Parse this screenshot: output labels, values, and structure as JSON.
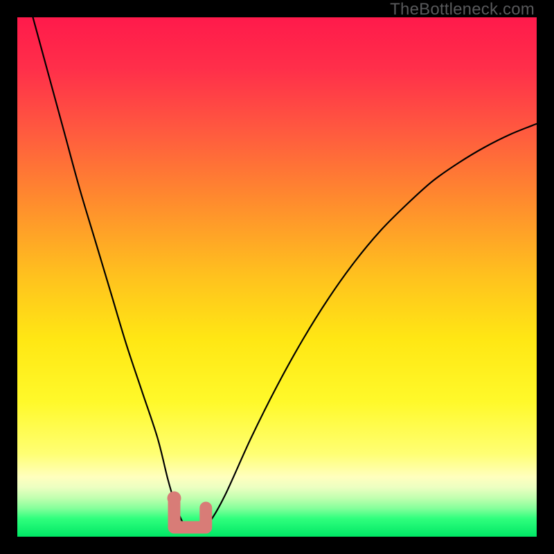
{
  "watermark": "TheBottleneck.com",
  "colors": {
    "frame": "#000000",
    "curve": "#000000",
    "marker": "#d87c77",
    "gradient_stops": [
      {
        "offset": 0.0,
        "color": "#ff1a4b"
      },
      {
        "offset": 0.1,
        "color": "#ff2f4a"
      },
      {
        "offset": 0.22,
        "color": "#ff5a3f"
      },
      {
        "offset": 0.35,
        "color": "#ff8a2e"
      },
      {
        "offset": 0.5,
        "color": "#ffc21e"
      },
      {
        "offset": 0.62,
        "color": "#ffe714"
      },
      {
        "offset": 0.74,
        "color": "#fff92a"
      },
      {
        "offset": 0.84,
        "color": "#ffff73"
      },
      {
        "offset": 0.885,
        "color": "#ffffbe"
      },
      {
        "offset": 0.905,
        "color": "#ecffc1"
      },
      {
        "offset": 0.925,
        "color": "#c2ffb0"
      },
      {
        "offset": 0.945,
        "color": "#86ff9b"
      },
      {
        "offset": 0.965,
        "color": "#30ff7d"
      },
      {
        "offset": 1.0,
        "color": "#00e765"
      }
    ]
  },
  "chart_data": {
    "type": "line",
    "title": "",
    "xlabel": "",
    "ylabel": "",
    "xlim": [
      0,
      100
    ],
    "ylim": [
      0,
      100
    ],
    "series": [
      {
        "name": "bottleneck-curve",
        "x": [
          3,
          6,
          9,
          12,
          15,
          18,
          21,
          24,
          27,
          29,
          30.5,
          32,
          33.5,
          35,
          37,
          40,
          45,
          50,
          55,
          60,
          65,
          70,
          75,
          80,
          85,
          90,
          95,
          100
        ],
        "y": [
          100,
          89,
          78,
          67,
          57,
          47,
          37,
          28,
          19,
          11,
          6,
          2.5,
          1.2,
          1.2,
          2.8,
          8,
          19,
          29,
          38,
          46,
          53,
          59,
          64,
          68.5,
          72,
          75,
          77.5,
          79.5
        ]
      }
    ],
    "markers": [
      {
        "name": "optimum-range",
        "x_start": 30.2,
        "x_end": 36.3,
        "y": 1.8
      }
    ],
    "grid": false,
    "legend": false
  }
}
